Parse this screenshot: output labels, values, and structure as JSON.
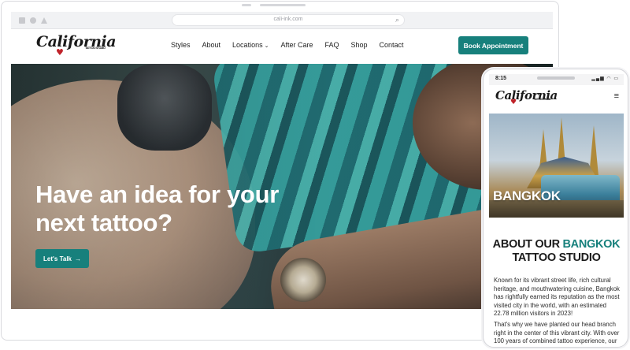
{
  "desktop": {
    "browser": {
      "url": "cali-ink.com"
    },
    "brand": {
      "logo_text": "California",
      "tagline": "TATTOO STUDIO"
    },
    "nav": [
      {
        "label": "Styles"
      },
      {
        "label": "About"
      },
      {
        "label": "Locations",
        "has_dropdown": true
      },
      {
        "label": "After Care"
      },
      {
        "label": "FAQ"
      },
      {
        "label": "Shop"
      },
      {
        "label": "Contact"
      }
    ],
    "book_button": "Book Appointment",
    "hero": {
      "title": "Have an idea for your next tattoo?",
      "cta": "Let's Talk",
      "cta_arrow": "→"
    }
  },
  "mobile": {
    "status": {
      "time": "8:15",
      "icons": "▂▄▆ ◠ ▭"
    },
    "brand": {
      "logo_text": "California",
      "tagline": "TATTOO STUDIO"
    },
    "menu_glyph": "≡",
    "city_banner": "BANGKOK",
    "about": {
      "pre": "ABOUT OUR ",
      "accent": "BANGKOK",
      "post": "TATTOO STUDIO"
    },
    "paragraphs": [
      "Known for its vibrant street life, rich cultural heritage, and mouthwatering cuisine, Bangkok has rightfully earned its reputation as the most visited city in the world, with an estimated 22.78 million visitors in 2023!",
      "That's why we have planted our head branch right in the center of this vibrant city. With over 100 years of combined tattoo experience, our Bangkok tattoo studio is sur"
    ]
  },
  "colors": {
    "accent": "#17807c",
    "logo_heart": "#c0232a",
    "text": "#222222"
  },
  "icons": [
    "search-icon",
    "chevron-down-icon",
    "arrow-right-icon",
    "hamburger-menu-icon",
    "heart-icon"
  ]
}
